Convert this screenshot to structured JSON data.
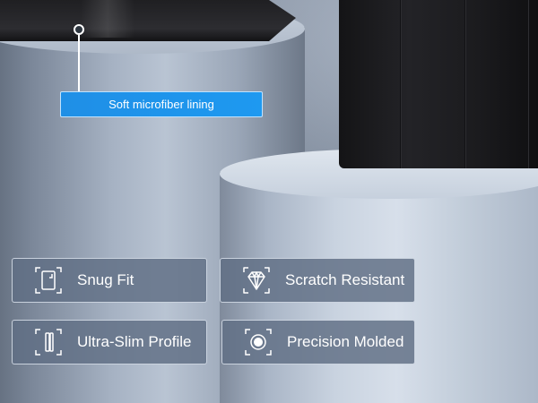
{
  "callout": {
    "label": "Soft microfiber lining"
  },
  "features": [
    {
      "label": "Snug Fit",
      "icon": "tablet-icon"
    },
    {
      "label": "Scratch Resistant",
      "icon": "diamond-icon"
    },
    {
      "label": "Ultra-Slim Profile",
      "icon": "slim-profile-icon"
    },
    {
      "label": "Precision Molded",
      "icon": "target-circle-icon"
    }
  ],
  "colors": {
    "callout_blue": "#1e99f0",
    "badge_fill": "#5f6e84",
    "case_black": "#1b1b1e"
  }
}
